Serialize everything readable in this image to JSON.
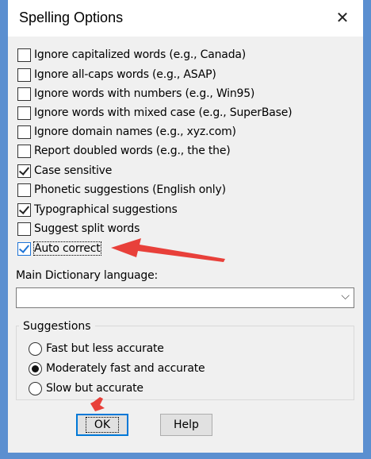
{
  "dialog": {
    "title": "Spelling Options",
    "close_icon": "close-icon"
  },
  "options": [
    {
      "label": "Ignore capitalized words (e.g., Canada)",
      "checked": false
    },
    {
      "label": "Ignore all-caps words (e.g., ASAP)",
      "checked": false
    },
    {
      "label": "Ignore words with numbers (e.g., Win95)",
      "checked": false
    },
    {
      "label": "Ignore words with mixed case (e.g., SuperBase)",
      "checked": false
    },
    {
      "label": "Ignore domain names (e.g., xyz.com)",
      "checked": false
    },
    {
      "label": "Report doubled words (e.g., the the)",
      "checked": false
    },
    {
      "label": "Case sensitive",
      "checked": true
    },
    {
      "label": "Phonetic suggestions (English only)",
      "checked": false
    },
    {
      "label": "Typographical suggestions",
      "checked": true
    },
    {
      "label": "Suggest split words",
      "checked": false
    },
    {
      "label": "Auto correct",
      "checked": true
    }
  ],
  "dictionary": {
    "label": "Main Dictionary language:",
    "value": "",
    "chevron_icon": "chevron-down-icon"
  },
  "suggestions": {
    "group_label": "Suggestions",
    "choices": [
      {
        "label": "Fast but less accurate",
        "selected": false
      },
      {
        "label": "Moderately fast and accurate",
        "selected": true
      },
      {
        "label": "Slow but accurate",
        "selected": false
      }
    ]
  },
  "buttons": {
    "ok": "OK",
    "help": "Help"
  },
  "annotation": {
    "arrow_color": "#e8403a",
    "highlight_color": "#1e74d6"
  }
}
